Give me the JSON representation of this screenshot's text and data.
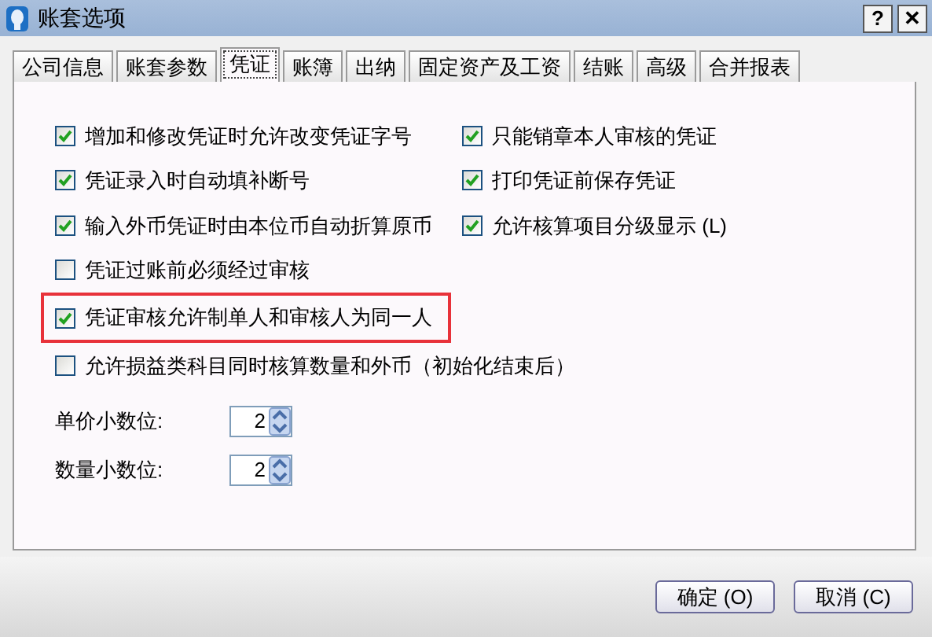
{
  "window": {
    "title": "账套选项",
    "help": "?",
    "close": "✕"
  },
  "tabs": [
    {
      "label": "公司信息",
      "selected": false
    },
    {
      "label": "账套参数",
      "selected": false
    },
    {
      "label": "凭证",
      "selected": true
    },
    {
      "label": "账簿",
      "selected": false
    },
    {
      "label": "出纳",
      "selected": false
    },
    {
      "label": "固定资产及工资",
      "selected": false
    },
    {
      "label": "结账",
      "selected": false
    },
    {
      "label": "高级",
      "selected": false
    },
    {
      "label": "合并报表",
      "selected": false
    }
  ],
  "left_options": [
    {
      "label": "增加和修改凭证时允许改变凭证字号",
      "checked": true,
      "highlighted": false
    },
    {
      "label": "凭证录入时自动填补断号",
      "checked": true,
      "highlighted": false
    },
    {
      "label": "输入外币凭证时由本位币自动折算原币",
      "checked": true,
      "highlighted": false
    },
    {
      "label": "凭证过账前必须经过审核",
      "checked": false,
      "highlighted": false
    },
    {
      "label": "凭证审核允许制单人和审核人为同一人",
      "checked": true,
      "highlighted": true
    }
  ],
  "right_options": [
    {
      "label": "只能销章本人审核的凭证",
      "checked": true,
      "highlighted": false
    },
    {
      "label": "打印凭证前保存凭证",
      "checked": true,
      "highlighted": false
    },
    {
      "label": "允许核算项目分级显示 (L)",
      "checked": true,
      "highlighted": false
    }
  ],
  "wide_options": [
    {
      "label": "允许损益类科目同时核算数量和外币（初始化结束后）",
      "checked": false,
      "highlighted": false
    }
  ],
  "spinners": [
    {
      "label": "单价小数位:",
      "value": "2"
    },
    {
      "label": "数量小数位:",
      "value": "2"
    }
  ],
  "buttons": [
    "确定 (O)",
    "取消 (C)"
  ]
}
